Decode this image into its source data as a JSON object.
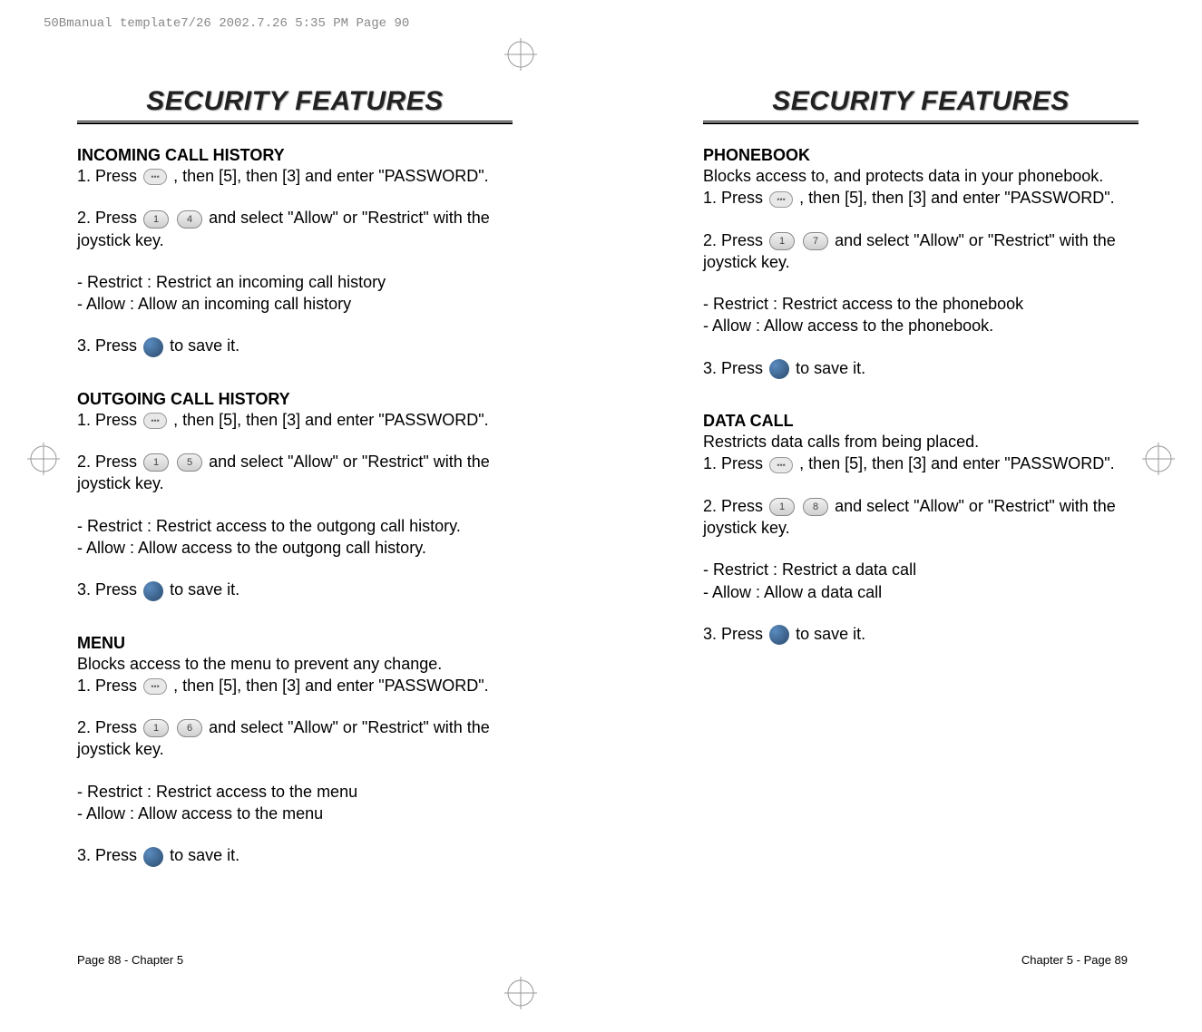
{
  "header_text": "50Bmanual template7/26  2002.7.26  5:35 PM  Page 90",
  "title_left": "SECURITY FEATURES",
  "title_right": "SECURITY FEATURES",
  "left": {
    "section1_heading": "INCOMING CALL HISTORY",
    "section1_step1": "1. Press",
    "section1_step1_after": ", then [5], then [3] and enter \"PASSWORD\".",
    "section1_step2": "2. Press",
    "section1_step2_after": "and select \"Allow\" or \"Restrict\" with the joystick key.",
    "section1_restrict": "- Restrict : Restrict an incoming call history",
    "section1_allow": "- Allow : Allow an incoming call history",
    "section1_step3": "3. Press",
    "section1_step3_after": "to save it.",
    "section2_heading": "OUTGOING CALL HISTORY",
    "section2_step1": "1. Press",
    "section2_step1_after": ", then [5], then [3] and enter \"PASSWORD\".",
    "section2_step2": "2. Press",
    "section2_step2_after": "and select \"Allow\" or \"Restrict\" with the joystick key.",
    "section2_restrict": "- Restrict : Restrict access to the outgong call history.",
    "section2_allow": "- Allow : Allow access to the outgong call history.",
    "section2_step3": "3. Press",
    "section2_step3_after": "to save it.",
    "section3_heading": "MENU",
    "section3_desc": "Blocks access to the menu to prevent any change.",
    "section3_step1": "1. Press",
    "section3_step1_after": ", then [5], then [3] and enter \"PASSWORD\".",
    "section3_step2": "2. Press",
    "section3_step2_after": "and select \"Allow\" or \"Restrict\" with the joystick key.",
    "section3_restrict": "- Restrict : Restrict access to the menu",
    "section3_allow": "- Allow : Allow access to the menu",
    "section3_step3": "3. Press",
    "section3_step3_after": "to save it."
  },
  "right": {
    "section1_heading": "PHONEBOOK",
    "section1_desc": "Blocks access to, and protects data in your phonebook.",
    "section1_step1": "1. Press",
    "section1_step1_after": ", then [5], then [3] and enter \"PASSWORD\".",
    "section1_step2": "2. Press",
    "section1_step2_after": "and select \"Allow\" or \"Restrict\" with the joystick key.",
    "section1_restrict": "- Restrict : Restrict access to the phonebook",
    "section1_allow": "- Allow : Allow access to the phonebook.",
    "section1_step3": "3. Press",
    "section1_step3_after": "to save it.",
    "section2_heading": "DATA CALL",
    "section2_desc": "Restricts data calls from being placed.",
    "section2_step1": "1. Press",
    "section2_step1_after": ", then [5], then [3] and enter \"PASSWORD\".",
    "section2_step2": "2. Press",
    "section2_step2_after": "and select \"Allow\" or \"Restrict\" with the joystick key.",
    "section2_restrict": "- Restrict : Restrict a data call",
    "section2_allow": "- Allow : Allow a data call",
    "section2_step3": "3. Press",
    "section2_step3_after": "to save it."
  },
  "key_labels": {
    "key1": "1",
    "key4": "4",
    "key5": "5",
    "key6": "6",
    "key7": "7",
    "key8": "8"
  },
  "footer_left": "Page 88 - Chapter 5",
  "footer_right": "Chapter 5 - Page 89"
}
